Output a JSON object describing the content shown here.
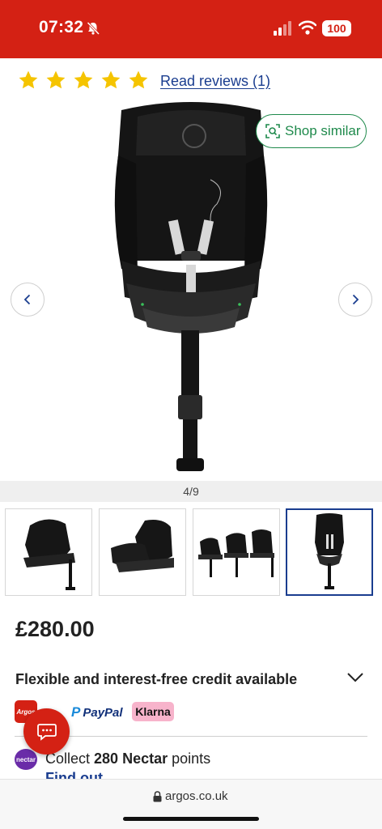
{
  "status_bar": {
    "time": "07:32",
    "battery": "100",
    "icons": [
      "bell-slash-icon",
      "cellular-signal-icon",
      "wifi-icon",
      "battery-icon"
    ]
  },
  "rating": {
    "stars": 5,
    "max_stars": 5,
    "reviews_link": "Read reviews (1)"
  },
  "gallery": {
    "shop_similar_label": "Shop similar",
    "counter": "4/9",
    "current_index": 4,
    "total": 9
  },
  "thumbnails": [
    {
      "name": "Car seat angled view with base"
    },
    {
      "name": "Car seat side view"
    },
    {
      "name": "Three car seat configurations"
    },
    {
      "name": "Car seat front view",
      "selected": true
    }
  ],
  "price": "£280.00",
  "credit": {
    "title": "Flexible and interest-free credit available",
    "providers": [
      "Argos",
      "PayPal",
      "Klarna"
    ]
  },
  "nectar": {
    "prefix": "Collect ",
    "points": "280 Nectar",
    "suffix": " points",
    "logo_text": "nectar",
    "find_out_more": "Find out more"
  },
  "browser": {
    "url": "argos.co.uk"
  },
  "colors": {
    "brand_red": "#d42114",
    "link_blue": "#1a3d8f",
    "star_yellow": "#f5c400",
    "shop_similar_green": "#1f8a4c",
    "klarna_pink": "#f7b3cb"
  }
}
